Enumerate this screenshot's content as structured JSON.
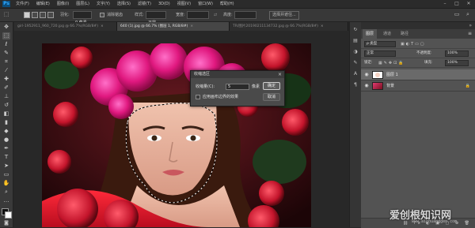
{
  "app": {
    "logo": "Ps",
    "menus": [
      "文件(F)",
      "编辑(E)",
      "图像(I)",
      "图层(L)",
      "文字(Y)",
      "选择(S)",
      "滤镜(T)",
      "3D(D)",
      "视图(V)",
      "窗口(W)",
      "帮助(H)"
    ]
  },
  "options_bar": {
    "feather_label": "羽化:",
    "feather_value": "0 像素",
    "antialias_label": "消除锯齿",
    "style_label": "样式:",
    "style_value": "正常",
    "width_label": "宽度:",
    "height_label": "高度:",
    "select_mask_label": "选择并遮住..."
  },
  "tabs": [
    {
      "label": "girl-1952911_960_720.jpg @ 66.7%(RGB/8#)",
      "active": false
    },
    {
      "label": "640 (1).jpg @ 66.7% (图层 1, RGB/8#)",
      "active": true
    },
    {
      "label": "TR/图片20190211134732.jpg @ 66.7%(RGB/8#)",
      "active": false
    }
  ],
  "panel": {
    "tabs": [
      "图层",
      "通道",
      "路径"
    ],
    "kind_label": "ρ 类型",
    "blend_mode": "正常",
    "opacity_label": "不透明度:",
    "opacity_value": "100%",
    "lock_label": "锁定:",
    "fill_label": "填充:",
    "fill_value": "100%",
    "layers": [
      {
        "name": "图层 1",
        "visible": true,
        "selected": true
      },
      {
        "name": "背景",
        "visible": true,
        "selected": false,
        "locked": true
      }
    ]
  },
  "dialog": {
    "title": "收缩选区",
    "shrink_label": "收缩量(C):",
    "shrink_value": "5",
    "unit": "像素",
    "edge_checkbox_label": "应用画布边界的效果",
    "ok_label": "确定",
    "cancel_label": "取消"
  },
  "watermark": {
    "text": "爱创根知识网",
    "url": "www.aichuanggen.com"
  },
  "colors": {
    "ps_blue": "#31a8ff",
    "panel_bg": "#535353",
    "workspace": "#282828"
  }
}
